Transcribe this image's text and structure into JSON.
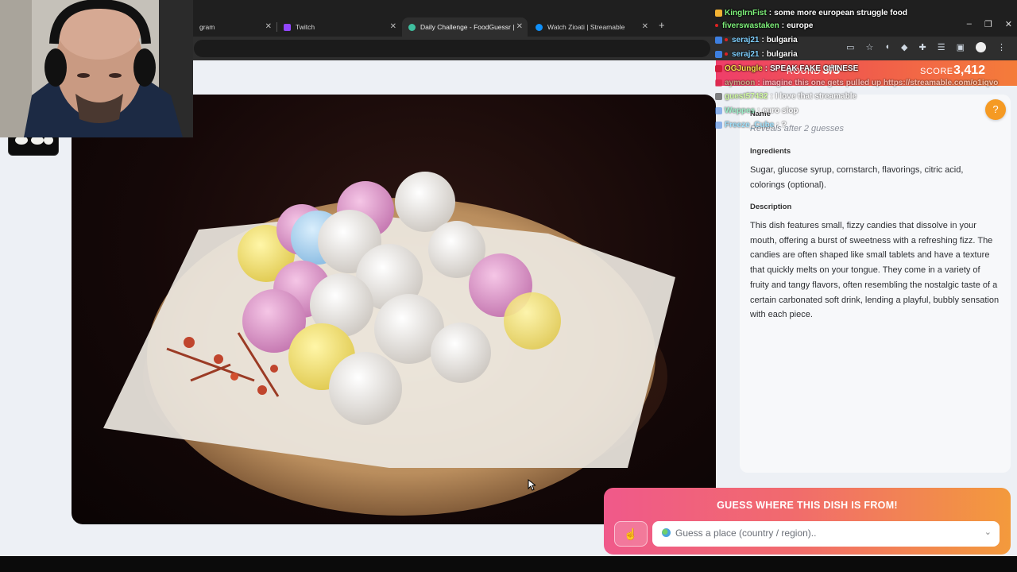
{
  "browser": {
    "tabs": [
      {
        "label": "gram",
        "icon": "instagram-icon"
      },
      {
        "label": "Twitch",
        "icon": "twitch-icon",
        "color": "#9146ff"
      },
      {
        "label": "Daily Challenge - FoodGuessr |",
        "icon": "foodguessr-icon",
        "color": "#3fbf9f",
        "active": true
      },
      {
        "label": "Watch Zioati | Streamable",
        "icon": "streamable-icon",
        "color": "#0f90fa"
      }
    ],
    "new_tab": "+",
    "window_controls": [
      "–",
      "❐",
      "✕"
    ]
  },
  "game": {
    "round_label": "ROUND",
    "round_value": "3/3",
    "score_label": "SCORE",
    "score_value": "3,412",
    "help_icon": "?",
    "name_heading": "Name",
    "name_hint": "Reveals after 2 guesses",
    "ingredients_heading": "Ingredients",
    "ingredients_text": "Sugar, glucose syrup, cornstarch, flavorings, citric acid, colorings (optional).",
    "description_heading": "Description",
    "description_text": "This dish features small, fizzy candies that dissolve in your mouth, offering a burst of sweetness with a refreshing fizz. The candies are often shaped like small tablets and have a texture that quickly melts on your tongue. They come in a variety of fruity and tangy flavors, often resembling the nostalgic taste of a certain carbonated soft drink, lending a playful, bubbly sensation with each piece.",
    "guess_title": "GUESS WHERE THIS DISH IS FROM!",
    "hint_icon": "hand-icon",
    "guess_placeholder": "Guess a place (country / region)..",
    "accent": "#f16a6e"
  },
  "chat": [
    {
      "user": "KingIrnFist",
      "text": "some more european struggle food",
      "user_color": "#7ef07a"
    },
    {
      "user": "fiverswastaken",
      "text": "europe",
      "user_color": "#7ef07a"
    },
    {
      "user": "seraj21",
      "text": "bulgaria",
      "user_color": "#7fd0ff"
    },
    {
      "user": "seraj21",
      "text": "bulgaria",
      "user_color": "#7fd0ff"
    },
    {
      "user": "OGJungle",
      "text": "SPEAK FAKE CHINESE",
      "user_color": "#ffe14a"
    },
    {
      "user": "aymoon",
      "text": "imagine this one gets pulled up https://streamable.com/o1iqvo",
      "user_color": "#9ff09a"
    },
    {
      "user": "guest57432",
      "text": "I love that streamable",
      "user_color": "#b6ff5a"
    },
    {
      "user": "Weppes",
      "text": "euro slop",
      "user_color": "#56e8a0"
    },
    {
      "user": "Freeze_Cube",
      "text": "?",
      "user_color": "#5ad0ff"
    }
  ]
}
